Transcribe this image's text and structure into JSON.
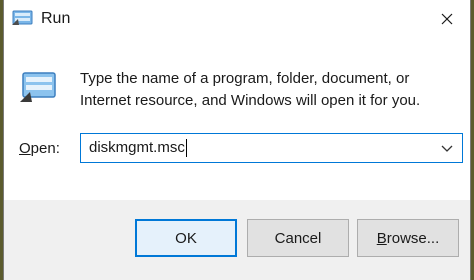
{
  "window": {
    "title": "Run"
  },
  "description": {
    "line1": "Type the name of a program, folder, document, or",
    "line2": "Internet resource, and Windows will open it for you."
  },
  "open_field": {
    "label_prefix": "",
    "label_underlined": "O",
    "label_rest": "pen:",
    "value": "diskmgmt.msc"
  },
  "buttons": {
    "ok": "OK",
    "cancel": "Cancel",
    "browse_underlined": "B",
    "browse_rest": "rowse..."
  },
  "icons": {
    "title": "run-icon",
    "content": "run-icon",
    "close": "close-icon",
    "dropdown": "chevron-down-icon"
  },
  "colors": {
    "focus_border": "#0078d7",
    "button_bg": "#e1e1e1"
  }
}
